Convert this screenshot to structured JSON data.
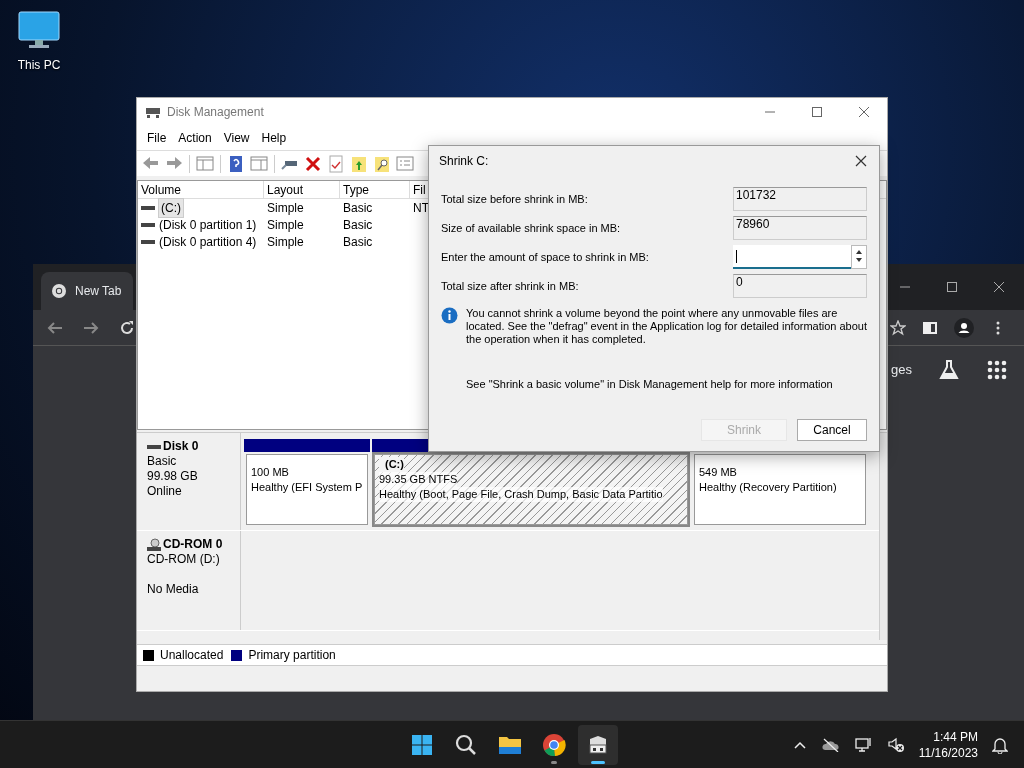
{
  "desktop": {
    "icons": [
      {
        "label": "This PC"
      }
    ]
  },
  "browser_window": {
    "tab": {
      "title": "New Tab",
      "selected": true
    },
    "content_text": "ges"
  },
  "disk_management": {
    "title": "Disk Management",
    "menu": [
      "File",
      "Action",
      "View",
      "Help"
    ],
    "volume_list": {
      "columns": [
        "Volume",
        "Layout",
        "Type",
        "Fil"
      ],
      "rows": [
        {
          "cells": [
            "(C:)",
            "Simple",
            "Basic",
            "NT"
          ],
          "selected": true
        },
        {
          "cells": [
            "(Disk 0 partition 1)",
            "Simple",
            "Basic"
          ],
          "selected": false
        },
        {
          "cells": [
            "(Disk 0 partition 4)",
            "Simple",
            "Basic"
          ],
          "selected": false
        }
      ]
    },
    "disks": [
      {
        "kind": "disk",
        "name": "Disk 0",
        "type": "Basic",
        "size": "99.98 GB",
        "status": "Online",
        "partitions": [
          {
            "size": "100 MB",
            "health": "Healthy (EFI System P",
            "selected": false
          },
          {
            "name": "(C:)",
            "size": "99.35 GB NTFS",
            "health": "Healthy (Boot, Page File, Crash Dump, Basic Data Partitio",
            "selected": true
          },
          {
            "size": "549 MB",
            "health": "Healthy (Recovery Partition)",
            "selected": false
          }
        ]
      },
      {
        "kind": "cdrom",
        "name": "CD-ROM 0",
        "type": "CD-ROM (D:)",
        "status": "No Media"
      }
    ],
    "legend": [
      {
        "label": "Unallocated",
        "color": "#000000"
      },
      {
        "label": "Primary partition",
        "color": "#000080"
      }
    ]
  },
  "dialog": {
    "title": "Shrink C:",
    "fields": [
      {
        "kind": "readonly",
        "label": "Total size before shrink in MB:",
        "value": "101732"
      },
      {
        "kind": "readonly",
        "label": "Size of available shrink space in MB:",
        "value": "78960"
      },
      {
        "kind": "spin",
        "label": "Enter the amount of space to shrink in MB:"
      },
      {
        "kind": "readonly",
        "label": "Total size after shrink in MB:",
        "value": "0"
      }
    ],
    "info": "You cannot shrink a volume beyond the point where any unmovable files are located. See the \"defrag\" event in the Application log for detailed information about the operation when it has completed.",
    "help": "See \"Shrink a basic volume\" in Disk Management help for more information",
    "buttons": [
      {
        "label": "Shrink",
        "disabled": true
      },
      {
        "label": "Cancel",
        "disabled": false
      }
    ]
  },
  "taskbar": {
    "apps": [
      {
        "kind": "start",
        "running": false,
        "selected": false
      },
      {
        "kind": "search",
        "running": false,
        "selected": false
      },
      {
        "kind": "explorer",
        "running": false,
        "selected": false
      },
      {
        "kind": "chrome",
        "running": true,
        "selected": false
      },
      {
        "kind": "diskmgmt",
        "running": true,
        "selected": true
      }
    ],
    "time": "1:44 PM",
    "date": "11/16/2023"
  }
}
